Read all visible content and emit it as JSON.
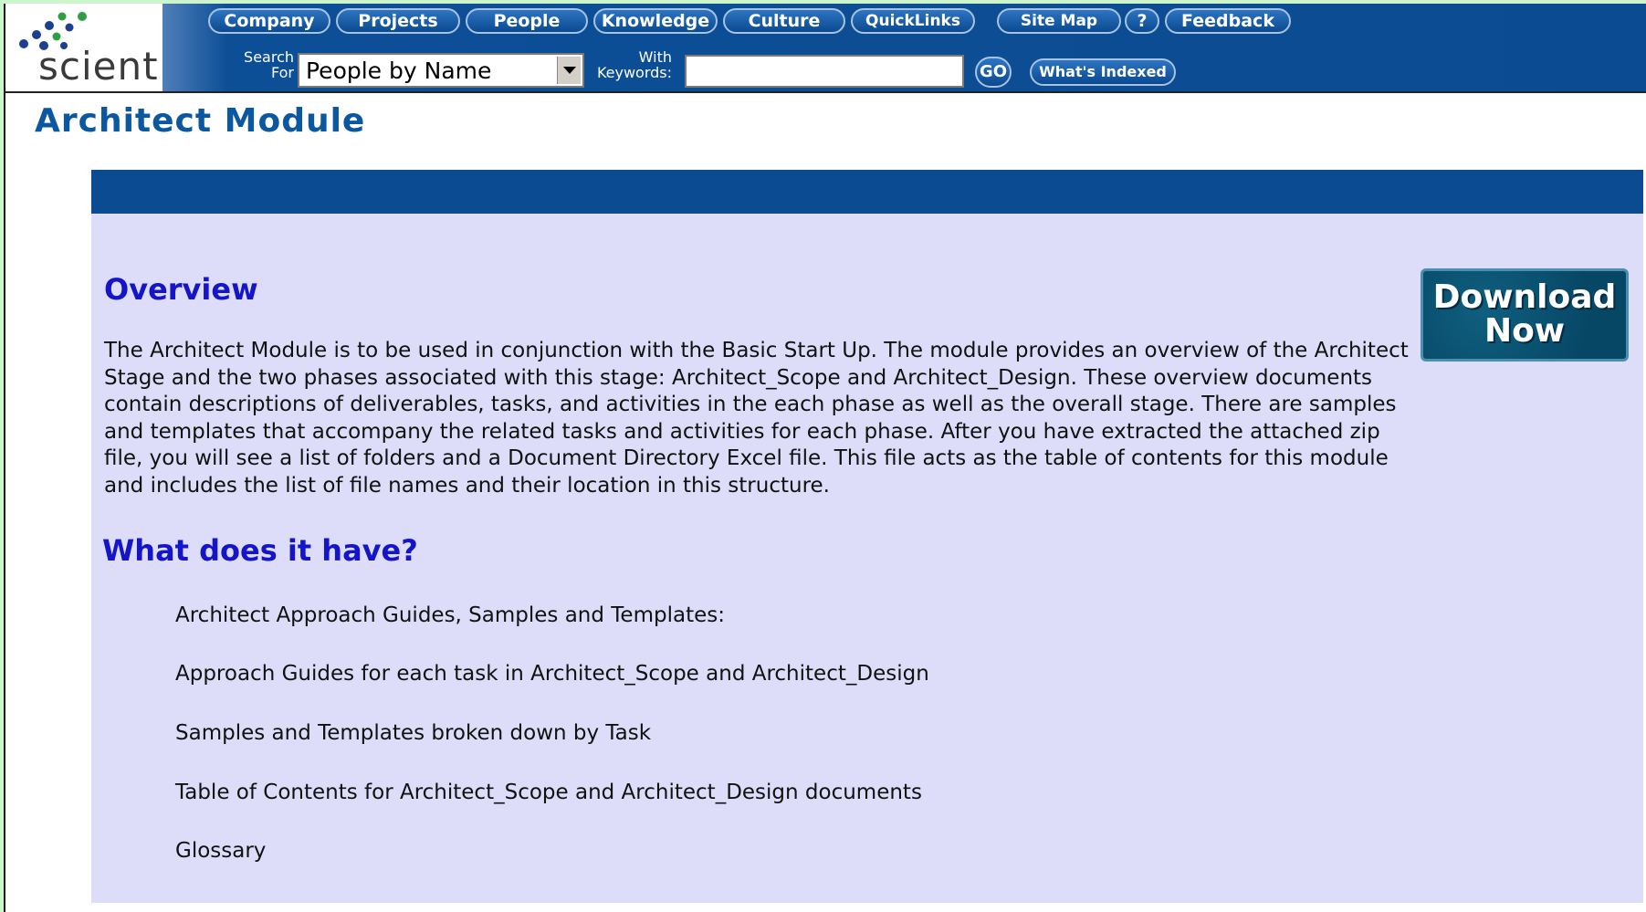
{
  "brand": {
    "logo_text": "scient",
    "logo_period": "."
  },
  "nav": {
    "items": [
      "Company",
      "Projects",
      "People",
      "Knowledge",
      "Culture",
      "QuickLinks"
    ],
    "site_map": "Site Map",
    "help": "?",
    "feedback": "Feedback"
  },
  "search": {
    "search_for_label_1": "Search",
    "search_for_label_2": "For",
    "select_value": "People by Name",
    "keywords_label_1": "With",
    "keywords_label_2": "Keywords:",
    "keywords_value": "",
    "go_label": "GO",
    "whats_indexed_label": "What's Indexed"
  },
  "page": {
    "title": "Architect Module",
    "download_line_1": "Download",
    "download_line_2": "Now",
    "overview_heading": "Overview",
    "overview_text": "The Architect Module is to be used in conjunction with the Basic Start Up. The module provides an overview of the Architect Stage and the two phases associated with this stage: Architect_Scope and Architect_Design. These overview documents contain descriptions of deliverables, tasks, and activities in the each phase as well as the overall stage. There are samples and templates that accompany the related tasks and activities for each phase. After you have extracted the attached zip file, you will see a list of folders and a Document Directory Excel file. This file acts as the table of contents for this module and includes the list of file names and their location in this structure.",
    "features_heading": "What does it have?",
    "features": [
      "Architect Approach Guides, Samples and Templates:",
      "Approach Guides for each task in Architect_Scope and Architect_Design",
      "Samples and Templates broken down by Task",
      "Table of Contents for Architect_Scope and Architect_Design documents",
      "Glossary"
    ]
  },
  "colors": {
    "nav_blue": "#0b4b91",
    "heading_blue": "#1414c8",
    "title_blue": "#0b57a0",
    "panel_lavender": "#ddddf9",
    "download_teal": "#074766"
  }
}
